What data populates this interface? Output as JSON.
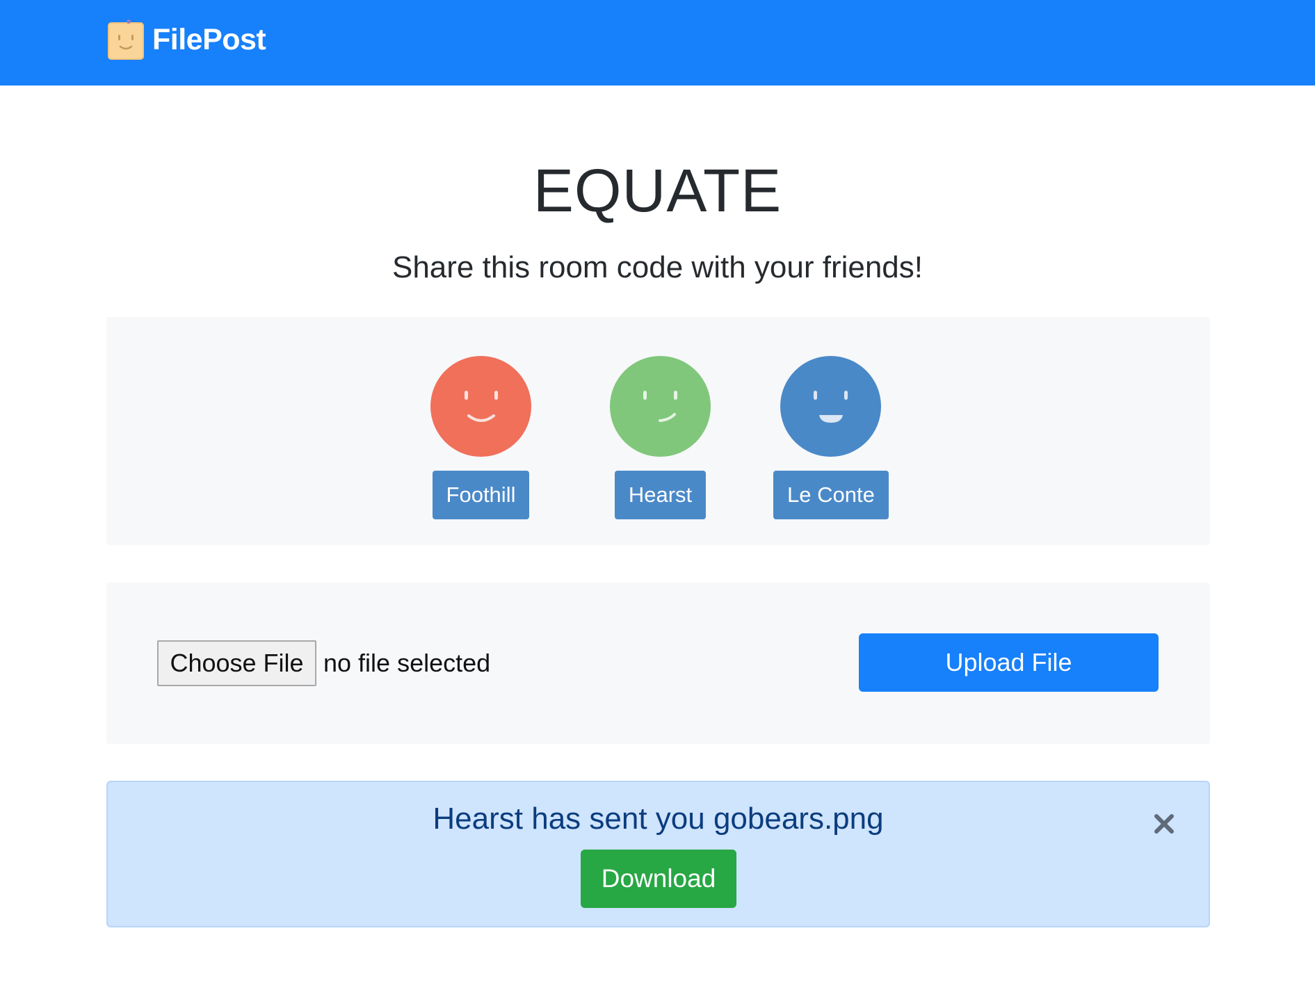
{
  "navbar": {
    "brand_name": "FilePost",
    "brand_icon": "smiley-note-icon",
    "background": "#1780fb"
  },
  "room": {
    "code": "EQUATE",
    "subtitle": "Share this room code with your friends!"
  },
  "users": [
    {
      "name": "Foothill",
      "avatar_color": "#f0705a",
      "expression": "smile"
    },
    {
      "name": "Hearst",
      "avatar_color": "#80c77b",
      "expression": "smirk"
    },
    {
      "name": "Le Conte",
      "avatar_color": "#4a89c8",
      "expression": "grin"
    }
  ],
  "upload": {
    "choose_label": "Choose File",
    "file_status": "no file selected",
    "upload_label": "Upload File"
  },
  "alert": {
    "message": "Hearst has sent you gobears.png",
    "download_label": "Download",
    "close_icon": "close-icon",
    "background": "#cfe4fd",
    "download_color": "#28a745"
  }
}
